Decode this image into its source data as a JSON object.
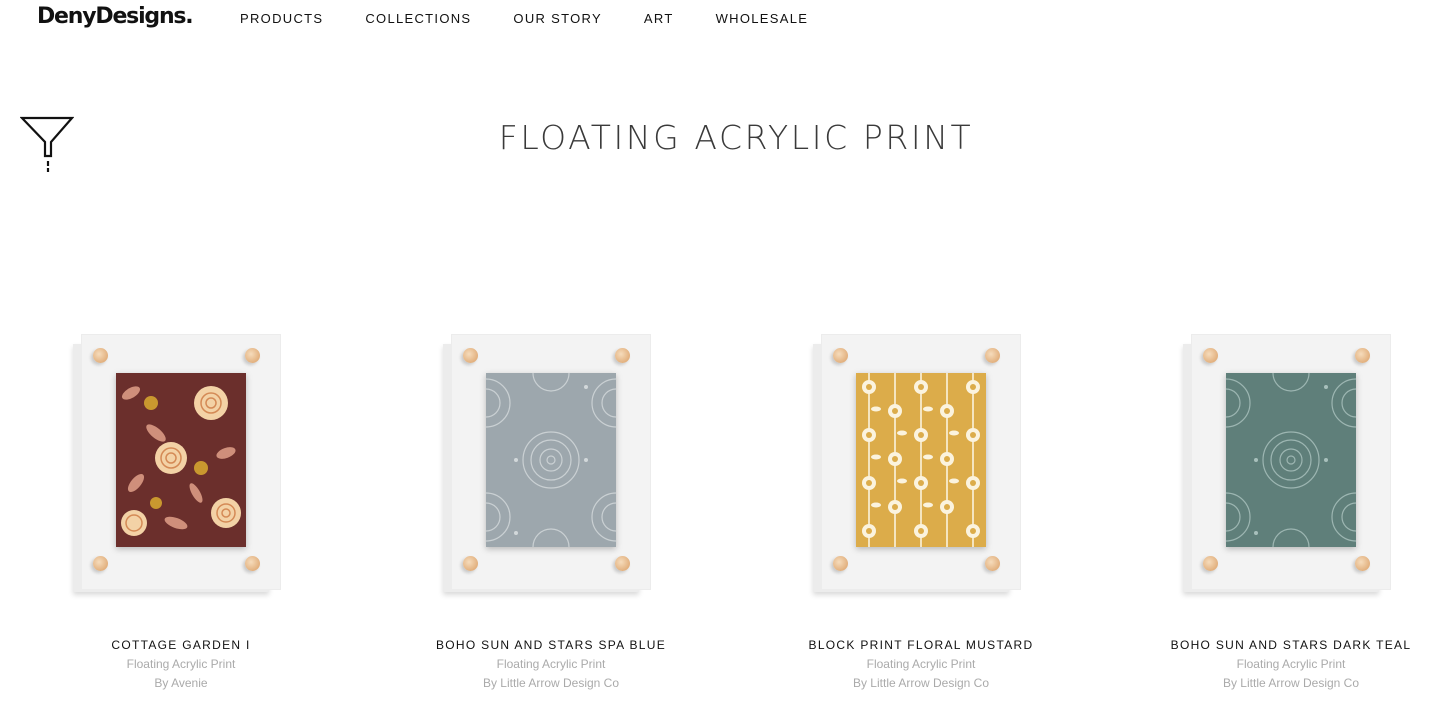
{
  "header": {
    "logo_text": "DenyDesigns.",
    "nav": [
      {
        "label": "PRODUCTS"
      },
      {
        "label": "COLLECTIONS"
      },
      {
        "label": "OUR STORY"
      },
      {
        "label": "ART"
      },
      {
        "label": "WHOLESALE"
      }
    ]
  },
  "filter": {
    "icon": "filter-funnel-icon"
  },
  "page": {
    "title": "FLOATING ACRYLIC PRINT"
  },
  "products": [
    {
      "name": "COTTAGE GARDEN I",
      "type": "Floating Acrylic Print",
      "artist": "By Avenie",
      "art_color": "#6b2f2c",
      "pattern": "floral"
    },
    {
      "name": "BOHO SUN AND STARS SPA BLUE",
      "type": "Floating Acrylic Print",
      "artist": "By Little Arrow Design Co",
      "art_color": "#9da7ad",
      "pattern": "boho-sun"
    },
    {
      "name": "BLOCK PRINT FLORAL MUSTARD",
      "type": "Floating Acrylic Print",
      "artist": "By Little Arrow Design Co",
      "art_color": "#dcac4a",
      "pattern": "block-floral"
    },
    {
      "name": "BOHO SUN AND STARS DARK TEAL",
      "type": "Floating Acrylic Print",
      "artist": "By Little Arrow Design Co",
      "art_color": "#5f7f7a",
      "pattern": "boho-sun"
    }
  ]
}
